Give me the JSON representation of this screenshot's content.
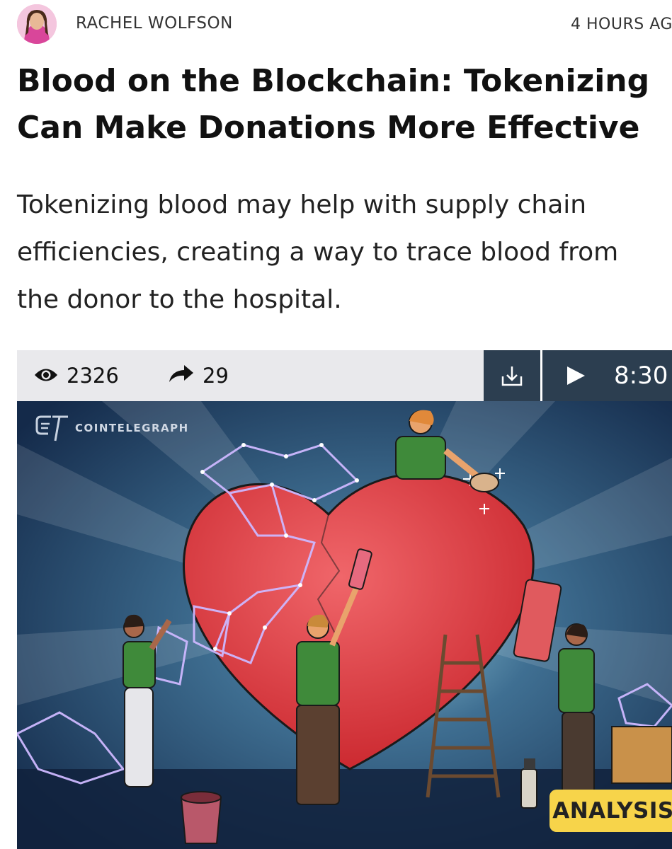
{
  "author": {
    "name": "RACHEL WOLFSON",
    "timestamp": "4 HOURS AG"
  },
  "article": {
    "title": "Blood on the Blockchain: Tokenizing Can Make Donations More Effective",
    "summary": "Tokenizing blood may help with supply chain efficiencies, creating a way to trace blood from the donor to the hospital."
  },
  "media_bar": {
    "views": "2326",
    "shares": "29",
    "duration": "8:30",
    "icons": {
      "views": "eye-icon",
      "shares": "share-arrow-icon",
      "download": "download-icon",
      "play": "play-icon"
    }
  },
  "hero": {
    "brand": "COINTELEGRAPH",
    "badge": "ANALYSIS"
  },
  "colors": {
    "controls_bg": "#2c3e50",
    "media_bar_bg": "#e9e9ec",
    "badge_bg": "#f7d44a",
    "heart": "#e43c3f",
    "hero_bg": "#1c3558"
  }
}
